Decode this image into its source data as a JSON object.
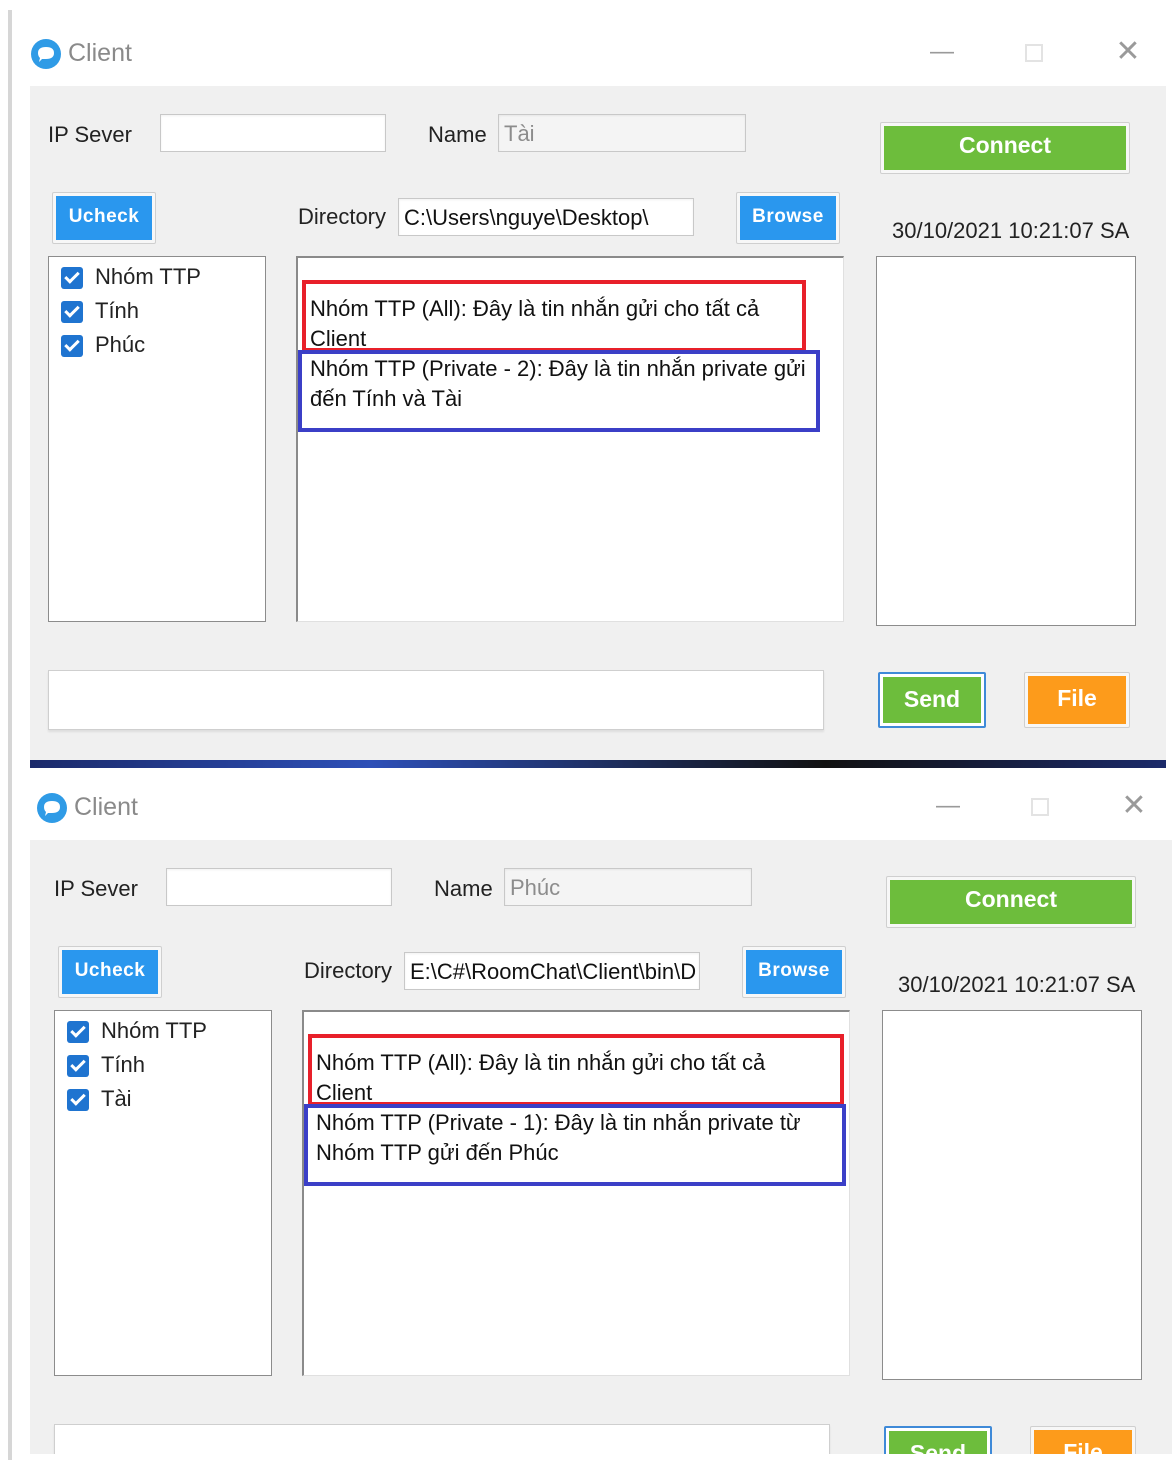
{
  "windows": [
    {
      "title": "Client",
      "ip_label": "IP Sever",
      "ip_value": "",
      "name_label": "Name",
      "name_value": "Tài",
      "connect_label": "Connect",
      "ucheck_label": "Ucheck",
      "directory_label": "Directory",
      "directory_value": "C:\\Users\\nguye\\Desktop\\",
      "browse_label": "Browse",
      "timestamp": "30/10/2021 10:21:07 SA",
      "users": [
        "Nhóm TTP",
        "Tính",
        "Phúc"
      ],
      "messages": [
        "Nhóm TTP (All): Đây là tin nhắn gửi cho tất cả Client",
        "Nhóm TTP (Private - 2): Đây là tin nhắn private gửi đến Tính và Tài"
      ],
      "message_input": "",
      "send_label": "Send",
      "file_label": "File"
    },
    {
      "title": "Client",
      "ip_label": "IP Sever",
      "ip_value": "",
      "name_label": "Name",
      "name_value": "Phúc",
      "connect_label": "Connect",
      "ucheck_label": "Ucheck",
      "directory_label": "Directory",
      "directory_value": "E:\\C#\\RoomChat\\Client\\bin\\D",
      "browse_label": "Browse",
      "timestamp": "30/10/2021 10:21:07 SA",
      "users": [
        "Nhóm TTP",
        "Tính",
        "Tài"
      ],
      "messages": [
        "Nhóm TTP (All): Đây là tin nhắn gửi cho tất cả Client",
        "Nhóm TTP (Private - 1): Đây là tin nhắn private từ Nhóm TTP gửi đến Phúc"
      ],
      "message_input": "",
      "send_label": "Send",
      "file_label": "File"
    }
  ],
  "colors": {
    "connect_green": "#6dbd3c",
    "browse_blue": "#2a97ee",
    "file_orange": "#fd9b1b",
    "highlight_red": "#e8202a",
    "highlight_blue": "#3b3fc7"
  },
  "icons": {
    "app": "chat-bubble-icon",
    "minimize": "minimize-icon",
    "maximize": "maximize-icon",
    "close": "close-icon",
    "checkbox": "checkbox-checked-icon"
  }
}
